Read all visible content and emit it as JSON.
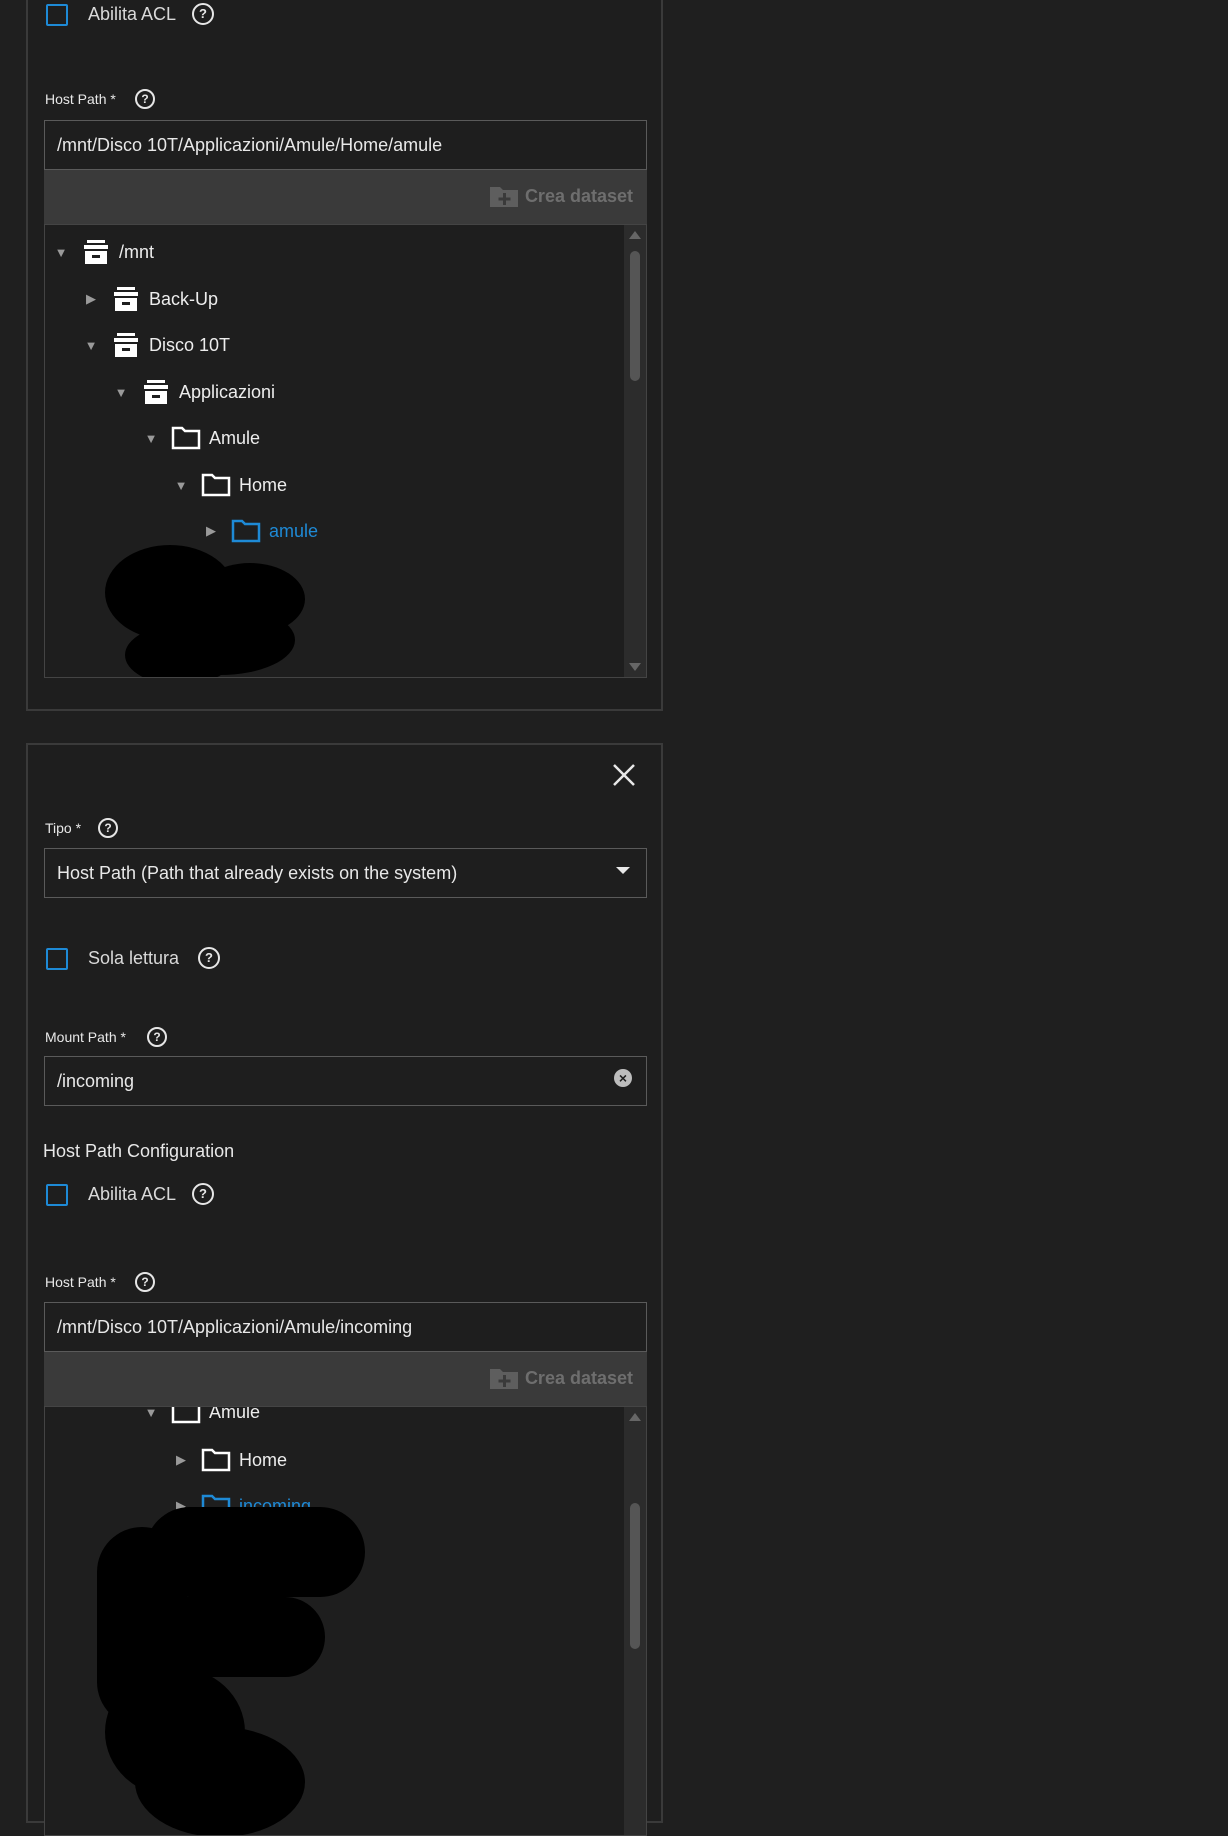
{
  "top_card": {
    "acl_label": "Abilita ACL",
    "host_path_label": "Host Path *",
    "host_path_value": "/mnt/Disco 10T/Applicazioni/Amule/Home/amule",
    "create_dataset_label": "Crea dataset",
    "tree": [
      {
        "label": "/mnt",
        "type": "dataset",
        "expanded": true
      },
      {
        "label": "Back-Up",
        "type": "dataset",
        "expanded": false
      },
      {
        "label": "Disco 10T",
        "type": "dataset",
        "expanded": true
      },
      {
        "label": "Applicazioni",
        "type": "dataset",
        "expanded": true
      },
      {
        "label": "Amule",
        "type": "folder",
        "expanded": true
      },
      {
        "label": "Home",
        "type": "folder",
        "expanded": true
      },
      {
        "label": "amule",
        "type": "folder",
        "expanded": false,
        "selected": true
      }
    ]
  },
  "bottom_card": {
    "close_icon": "close-icon",
    "type_label": "Tipo *",
    "type_value": "Host Path (Path that already exists on the system)",
    "readonly_label": "Sola lettura",
    "mount_path_label": "Mount Path *",
    "mount_path_value": "/incoming",
    "host_path_config_title": "Host Path Configuration",
    "acl_label": "Abilita ACL",
    "host_path_label": "Host Path *",
    "host_path_value": "/mnt/Disco 10T/Applicazioni/Amule/incoming",
    "create_dataset_label": "Crea dataset",
    "tree": [
      {
        "label": "Amule",
        "type": "folder",
        "expanded": true
      },
      {
        "label": "Home",
        "type": "folder",
        "expanded": false
      },
      {
        "label": "incoming",
        "type": "folder",
        "expanded": false,
        "selected": true
      }
    ]
  },
  "colors": {
    "accent": "#1e8ad6",
    "background": "#1f1f1f",
    "toolbar": "#3a3a3a"
  }
}
